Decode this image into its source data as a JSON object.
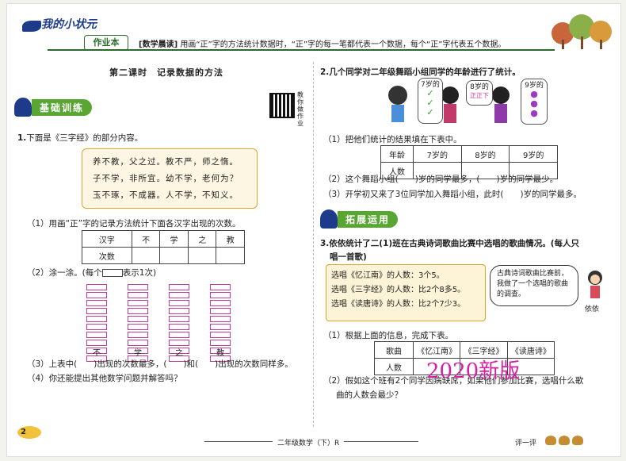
{
  "header": {
    "logo": "我的小状元",
    "badge": "作业本",
    "morning_read_title": "[数学晨读]",
    "morning_read_text": "用画“正”字的方法统计数据时，“正”字的每一笔都代表一个数据，每个“正”字代表五个数据。"
  },
  "lesson_title": "第二课时　记录数据的方法",
  "qr_label": "教你做作业",
  "section1": {
    "label": "基础训练",
    "q1": {
      "num": "1.",
      "text": "下面是《三字经》的部分内容。"
    },
    "poem": [
      "养不教，父之过。教不严，师之惰。",
      "子不学，非所宜。幼不学，老何为？",
      "玉不琢，不成器。人不学，不知义。"
    ],
    "sub1": "（1）用画“正”字的记录方法统计下面各汉字出现的次数。",
    "table1": {
      "headers": [
        "汉字",
        "不",
        "学",
        "之",
        "教"
      ],
      "row2_label": "次数"
    },
    "sub2_prefix": "（2）涂一涂。(每个",
    "sub2_suffix": "表示1次)",
    "tally_labels": [
      "不",
      "学",
      "之",
      "教"
    ],
    "sub3": "（3）上表中(　　)出现的次数最多，(　　)和(　　)出现的次数同样多。",
    "sub4": "（4）你还能提出其他数学问题并解答吗？"
  },
  "q2": {
    "num": "2.",
    "text": "几个同学对二年级舞蹈小组同学的年龄进行了统计。",
    "bubbles": [
      "7岁的",
      "8岁的",
      "9岁的"
    ],
    "bubble8_extra": "正正下",
    "sub1": "（1）把他们统计的结果填在下表中。",
    "table": {
      "headers": [
        "年龄",
        "7岁的",
        "8岁的",
        "9岁的"
      ],
      "row2_label": "人数"
    },
    "sub2": "（2）这个舞蹈小组(　　)岁的同学最多，(　　)岁的同学最少。",
    "sub3": "（3）开学初又来了3位同学加入舞蹈小组，此时(　　)岁的同学最多。"
  },
  "section2": {
    "label": "拓展运用",
    "q3": {
      "num": "3.",
      "text": "依依统计了二(1)班在古典诗词歌曲比赛中选唱的歌曲情况。(每人只",
      "text2": "唱一首歌)"
    },
    "info": [
      "选唱《忆江南》的人数：3个5。",
      "选唱《三字经》的人数：比2个8多5。",
      "选唱《读唐诗》的人数：比2个7少3。"
    ],
    "speech": "古典诗词歌曲比赛前，我做了一个选唱的歌曲的调查。",
    "girl_name": "依依",
    "sub1": "（1）根据上面的信息，完成下表。",
    "table": {
      "headers": [
        "歌曲",
        "《忆江南》",
        "《三字经》",
        "《读唐诗》"
      ],
      "row2_label": "人数"
    },
    "sub2": "（2）假如这个班有2个同学因病缺席，如果他们参加比赛，选唱什么歌",
    "sub2b": "曲的人数会最少？"
  },
  "watermark": "2020新版",
  "footer": {
    "text": "二年级数学（下）R",
    "page": "2",
    "rate": "评一评"
  },
  "colors": {
    "green": "#5aa632",
    "orange": "#e4a32a",
    "magenta": "#d81ea5",
    "navy": "#1d3b8a"
  }
}
